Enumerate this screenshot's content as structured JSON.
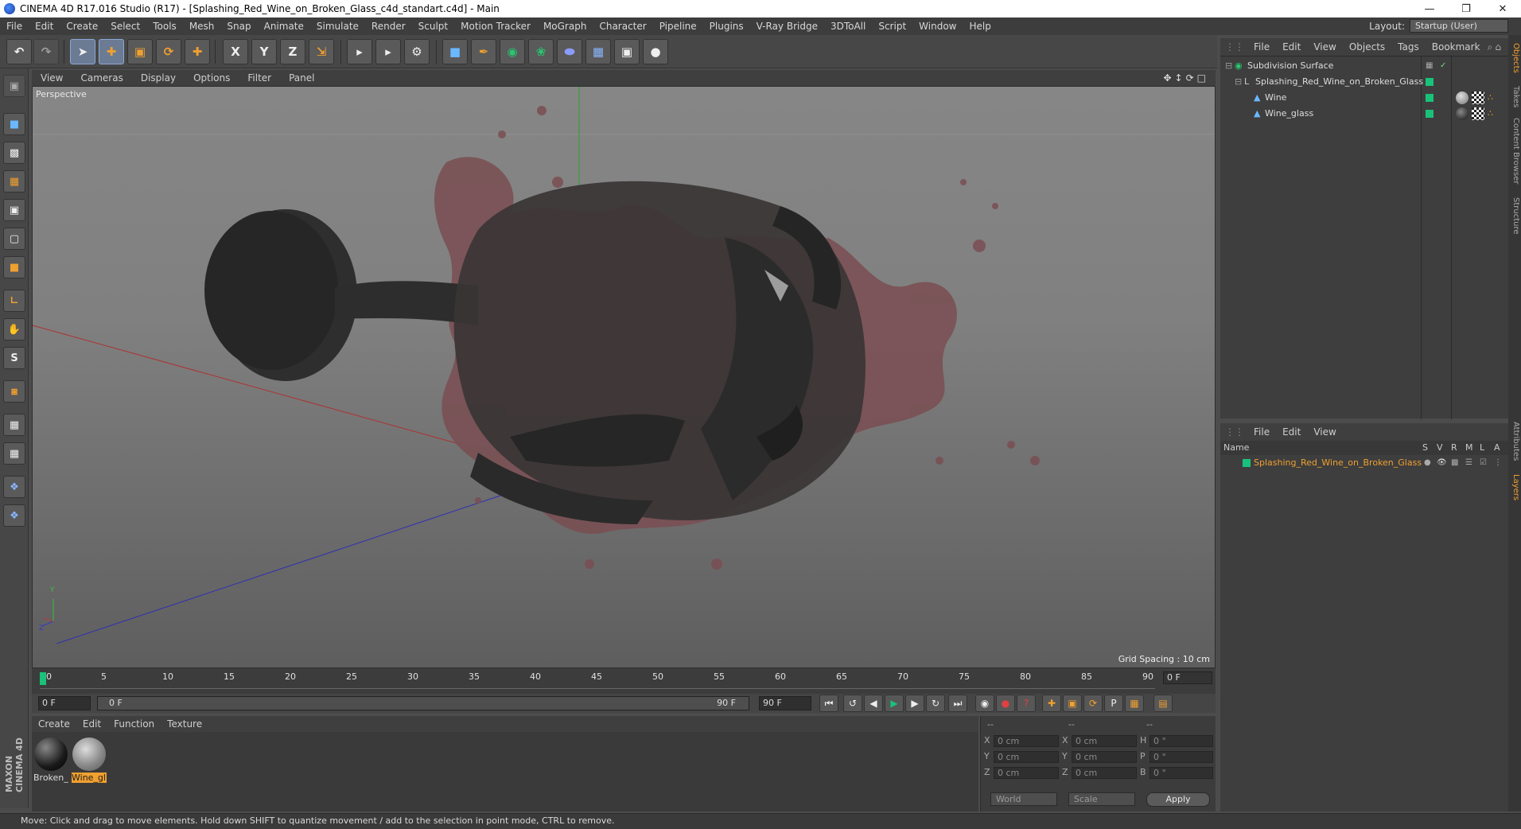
{
  "window": {
    "title": "CINEMA 4D R17.016 Studio (R17) - [Splashing_Red_Wine_on_Broken_Glass_c4d_standart.c4d] - Main"
  },
  "menu": [
    "File",
    "Edit",
    "Create",
    "Select",
    "Tools",
    "Mesh",
    "Snap",
    "Animate",
    "Simulate",
    "Render",
    "Sculpt",
    "Motion Tracker",
    "MoGraph",
    "Character",
    "Pipeline",
    "Plugins",
    "V-Ray Bridge",
    "3DToAll",
    "Script",
    "Window",
    "Help"
  ],
  "layout": {
    "label": "Layout:",
    "value": "Startup (User)"
  },
  "toolbar": {
    "x_label": "X",
    "y_label": "Y",
    "z_label": "Z"
  },
  "lefttools": {
    "s_label": "S"
  },
  "maxon_logo": "MAXON CINEMA 4D",
  "viewport": {
    "menu": [
      "View",
      "Cameras",
      "Display",
      "Options",
      "Filter",
      "Panel"
    ],
    "camera_label": "Perspective",
    "grid_spacing": "Grid Spacing : 10 cm",
    "axis_y": "Y",
    "axis_z": "Z"
  },
  "timeline": {
    "ticks": [
      "0",
      "5",
      "10",
      "15",
      "20",
      "25",
      "30",
      "35",
      "40",
      "45",
      "50",
      "55",
      "60",
      "65",
      "70",
      "75",
      "80",
      "85",
      "90"
    ],
    "current_frame": "0 F"
  },
  "transport": {
    "start": "0 F",
    "range_start": "0 F",
    "range_end": "90 F",
    "end": "90 F"
  },
  "materials": {
    "menu": [
      "Create",
      "Edit",
      "Function",
      "Texture"
    ],
    "items": [
      {
        "label": "Broken_"
      },
      {
        "label": "Wine_gl"
      }
    ]
  },
  "coords": {
    "headers": [
      "--",
      "--",
      "--"
    ],
    "rows": [
      {
        "a": "X",
        "av": "0 cm",
        "b": "X",
        "bv": "0 cm",
        "c": "H",
        "cv": "0 °"
      },
      {
        "a": "Y",
        "av": "0 cm",
        "b": "Y",
        "bv": "0 cm",
        "c": "P",
        "cv": "0 °"
      },
      {
        "a": "Z",
        "av": "0 cm",
        "b": "Z",
        "bv": "0 cm",
        "c": "B",
        "cv": "0 °"
      }
    ],
    "space": "World",
    "mode": "Scale",
    "apply": "Apply"
  },
  "objects": {
    "menu": [
      "File",
      "Edit",
      "View",
      "Objects",
      "Tags",
      "Bookmark"
    ],
    "tree": [
      {
        "name": "Subdivision Surface"
      },
      {
        "name": "Splashing_Red_Wine_on_Broken_Glass"
      },
      {
        "name": "Wine"
      },
      {
        "name": "Wine_glass"
      }
    ]
  },
  "layers": {
    "menu": [
      "File",
      "Edit",
      "View"
    ],
    "columns": {
      "name": "Name",
      "s": "S",
      "v": "V",
      "r": "R",
      "m": "M",
      "l": "L",
      "a": "A"
    },
    "items": [
      {
        "name": "Splashing_Red_Wine_on_Broken_Glass"
      }
    ]
  },
  "right_tabs": [
    "Objects",
    "Takes",
    "Content Browser",
    "Structure",
    "Attributes",
    "Layers"
  ],
  "colors": {
    "accent": "#f0a030",
    "layer_green": "#19c27a"
  },
  "status": "Move: Click and drag to move elements. Hold down SHIFT to quantize movement / add to the selection in point mode, CTRL to remove."
}
